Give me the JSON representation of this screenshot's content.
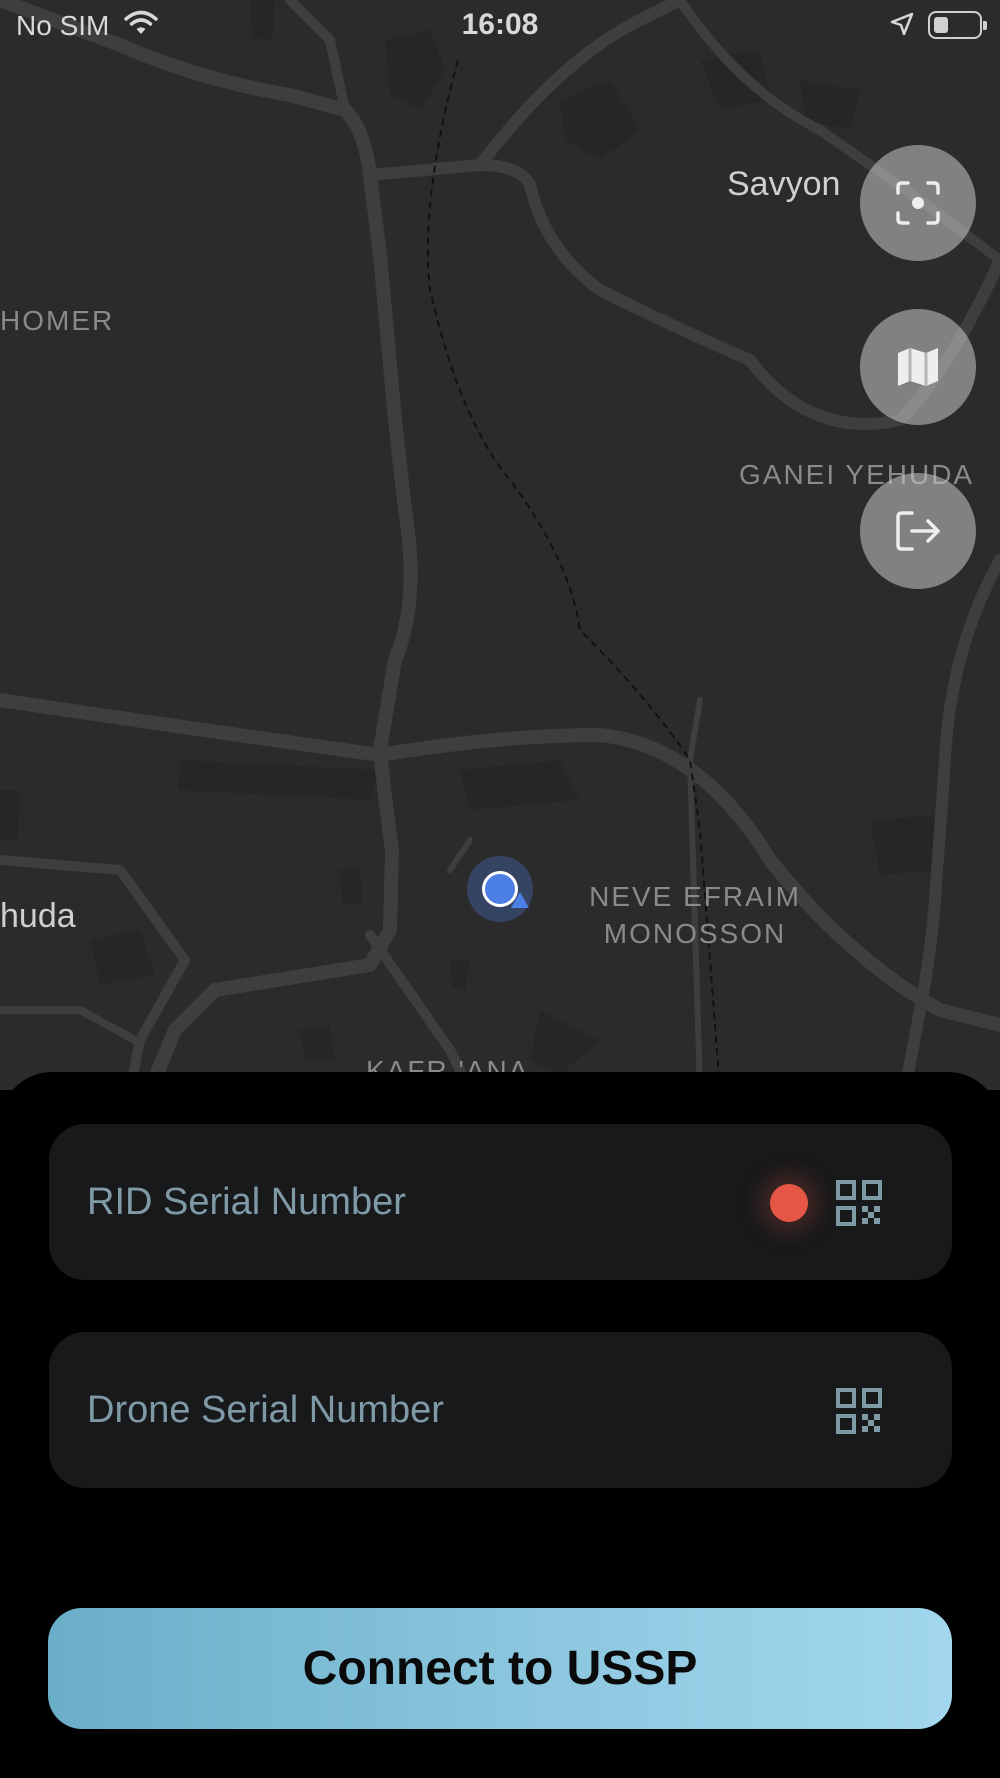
{
  "status_bar": {
    "carrier": "No SIM",
    "time": "16:08"
  },
  "map": {
    "labels": {
      "homer": "HOMER",
      "savyon": "Savyon",
      "ganei_yehuda": "GANEI YEHUDA",
      "yehuda_partial": "huda",
      "neve_efraim_line1": "NEVE EFRAIM",
      "neve_efraim_line2": "MONOSSON",
      "kafr_ana": "KAFR 'ANA"
    },
    "buttons": [
      "focus-location-icon",
      "map-icon",
      "logout-icon"
    ]
  },
  "form": {
    "rid_serial_placeholder": "RID Serial Number",
    "rid_status": "error",
    "drone_serial_placeholder": "Drone Serial Number",
    "connect_label": "Connect to USSP"
  },
  "colors": {
    "map_background": "#2b2b2c",
    "road": "#3e3e40",
    "field_background": "#18191b",
    "placeholder_text": "#7f9aa6",
    "status_error": "#e65646",
    "button_gradient_start": "#6aaec8",
    "button_gradient_end": "#a2d7ee",
    "user_location": "#4d80e6"
  }
}
